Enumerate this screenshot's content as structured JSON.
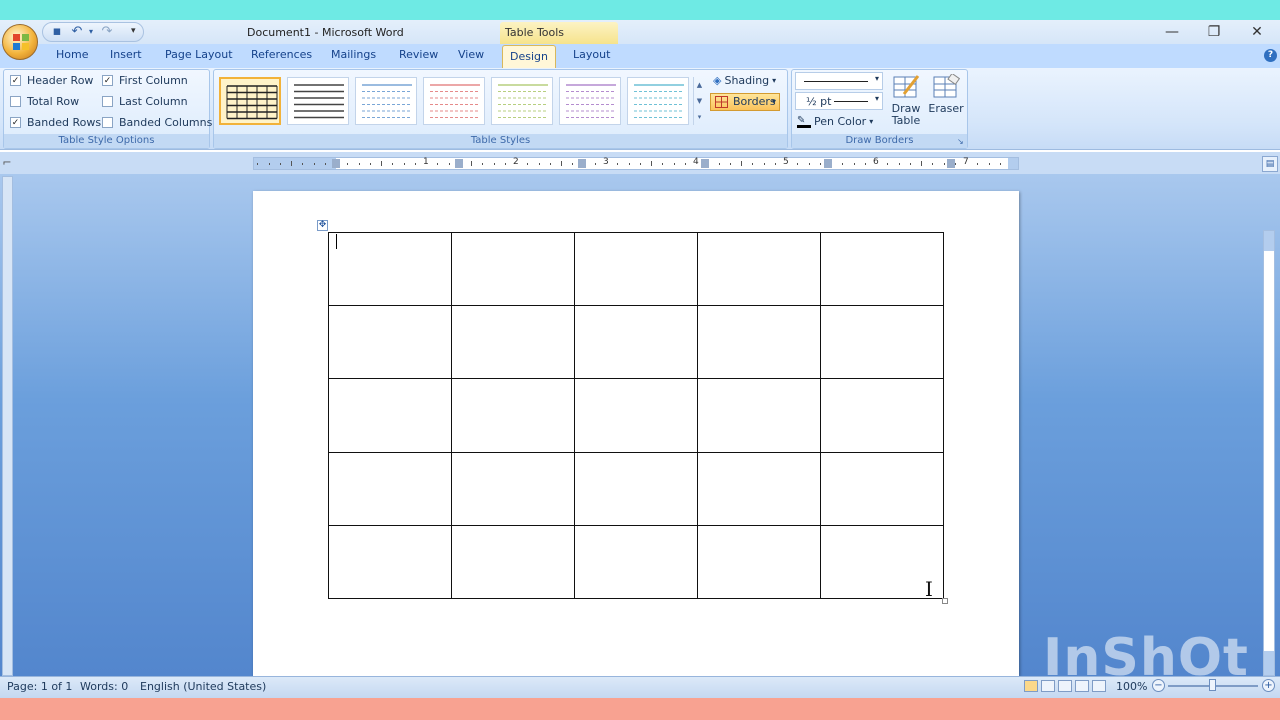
{
  "titlebar": {
    "document_title": "Document1 - Microsoft Word",
    "context_tab_group": "Table Tools",
    "qat_icons": [
      "save-icon",
      "undo-icon",
      "redo-icon"
    ],
    "customize_glyph": "▾",
    "window_controls": {
      "minimize": "—",
      "restore": "❐",
      "close": "✕"
    }
  },
  "tabs": [
    "Home",
    "Insert",
    "Page Layout",
    "References",
    "Mailings",
    "Review",
    "View",
    "Design",
    "Layout"
  ],
  "active_tab": "Design",
  "help": "?",
  "table_style_options": {
    "label": "Table Style Options",
    "options": [
      {
        "label": "Header Row",
        "checked": true
      },
      {
        "label": "First Column",
        "checked": true
      },
      {
        "label": "Total Row",
        "checked": false
      },
      {
        "label": "Last Column",
        "checked": false
      },
      {
        "label": "Banded Rows",
        "checked": true
      },
      {
        "label": "Banded Columns",
        "checked": false
      }
    ]
  },
  "table_styles": {
    "label": "Table Styles",
    "thumb_colors": [
      "#222222",
      "#444444",
      "#7aa6d6",
      "#e58a8a",
      "#b7cf7f",
      "#b48ccf",
      "#6fc1d6"
    ],
    "selected_index": 0,
    "shading_label": "Shading",
    "borders_label": "Borders"
  },
  "draw_borders": {
    "label": "Draw Borders",
    "pen_weight": "½ pt",
    "pen_color_label": "Pen Color",
    "draw_table_label_1": "Draw",
    "draw_table_label_2": "Table",
    "eraser_label": "Eraser"
  },
  "ruler": {
    "numbers": [
      "1",
      "2",
      "3",
      "4",
      "5",
      "6",
      "7"
    ]
  },
  "document": {
    "table_rows": 5,
    "table_cols": 5
  },
  "statusbar": {
    "page": "Page: 1 of 1",
    "words": "Words: 0",
    "language": "English (United States)",
    "zoom": "100%"
  },
  "watermark": "InShOt",
  "colors": {
    "ribbon_bg": "#dcebfc",
    "tab_text": "#15428b",
    "accent_selected": "#f2b23a",
    "workspace_blue": "#6b9fdc"
  }
}
